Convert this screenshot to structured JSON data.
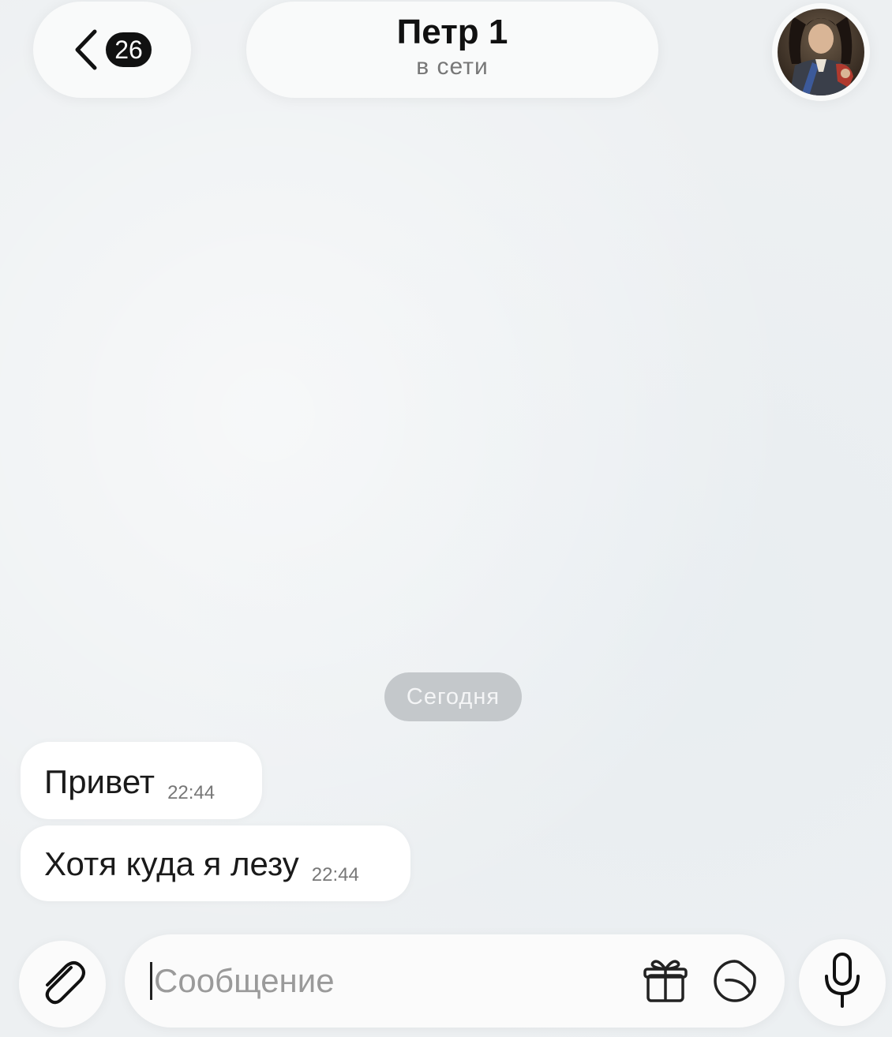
{
  "header": {
    "back_icon": "chevron-left-icon",
    "unread_count": "26",
    "title": "Петр 1",
    "status": "в сети",
    "avatar_icon": "contact-avatar-portrait"
  },
  "chat": {
    "date_separator": "Сегодня",
    "messages": [
      {
        "text": "Привет",
        "time": "22:44"
      },
      {
        "text": "Хотя куда я лезу",
        "time": "22:44"
      }
    ]
  },
  "composer": {
    "attach_icon": "paperclip-icon",
    "placeholder": "Сообщение",
    "value": "",
    "gift_icon": "gift-icon",
    "sticker_icon": "sticker-icon",
    "mic_icon": "microphone-icon"
  },
  "colors": {
    "background": "#edf0f2",
    "bubble": "#ffffff",
    "badge": "#111111",
    "date_chip": "#c4c8cb"
  }
}
